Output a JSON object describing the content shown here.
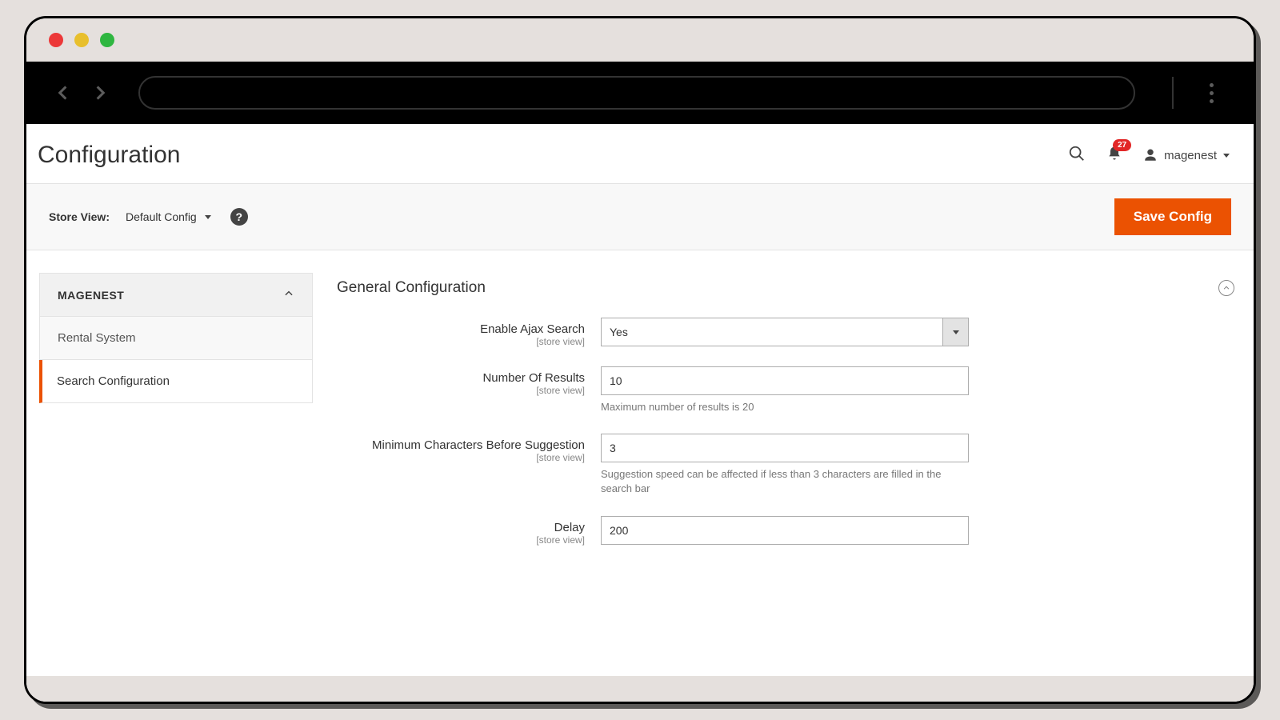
{
  "header": {
    "page_title": "Configuration",
    "notification_count": "27",
    "username": "magenest"
  },
  "toolbar": {
    "store_view_label": "Store View:",
    "store_view_value": "Default Config",
    "save_label": "Save Config"
  },
  "sidebar": {
    "group_label": "MAGENEST",
    "items": [
      {
        "label": "Rental System",
        "active": false
      },
      {
        "label": "Search Configuration",
        "active": true
      }
    ]
  },
  "section": {
    "title": "General Configuration",
    "scope_label": "[store view]",
    "fields": {
      "enable": {
        "label": "Enable Ajax Search",
        "value": "Yes"
      },
      "results": {
        "label": "Number Of Results",
        "value": "10",
        "note": "Maximum number of results is 20"
      },
      "minchars": {
        "label": "Minimum Characters Before Suggestion",
        "value": "3",
        "note": "Suggestion speed can be affected if less than 3 characters are filled in the search bar"
      },
      "delay": {
        "label": "Delay",
        "value": "200"
      }
    }
  }
}
